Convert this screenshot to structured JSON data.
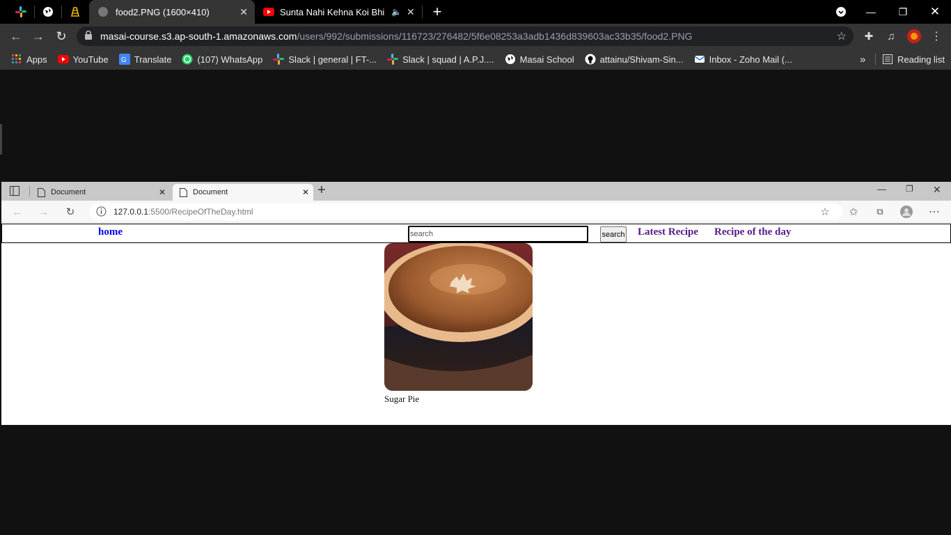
{
  "outer_browser": {
    "tabs": [
      {
        "title": "food2.PNG (1600×410)",
        "active": true
      },
      {
        "title": "Sunta Nahi Kehna Koi Bhi | R",
        "active": false
      }
    ],
    "url_host": "masai-course.s3.ap-south-1.amazonaws.com",
    "url_path": "/users/992/submissions/116723/276482/5f6e08253a3adb1436d839603ac33b35/food2.PNG",
    "bookmarks": [
      {
        "label": "Apps",
        "icon": "apps-grid-icon"
      },
      {
        "label": "YouTube",
        "icon": "youtube-icon"
      },
      {
        "label": "Translate",
        "icon": "translate-icon"
      },
      {
        "label": "(107) WhatsApp",
        "icon": "whatsapp-icon"
      },
      {
        "label": "Slack | general | FT-...",
        "icon": "slack-icon"
      },
      {
        "label": "Slack | squad | A.P.J....",
        "icon": "slack-icon"
      },
      {
        "label": "Masai School",
        "icon": "globe-icon"
      },
      {
        "label": "attainu/Shivam-Sin...",
        "icon": "github-icon"
      },
      {
        "label": "Inbox - Zoho Mail (...",
        "icon": "zoho-mail-icon"
      }
    ],
    "reading_list": "Reading list",
    "more_bookmarks": "»"
  },
  "inner_browser": {
    "tabs": [
      {
        "title": "Document",
        "active": false
      },
      {
        "title": "Document",
        "active": true
      }
    ],
    "url_host": "127.0.0.1",
    "url_rest": ":5500/RecipeOfTheDay.html"
  },
  "page": {
    "nav": {
      "home": "home",
      "search_placeholder": "search",
      "search_button": "search",
      "latest": "Latest Recipe",
      "recipe_of_day": "Recipe of the day"
    },
    "recipe": {
      "name": "Sugar Pie"
    }
  }
}
